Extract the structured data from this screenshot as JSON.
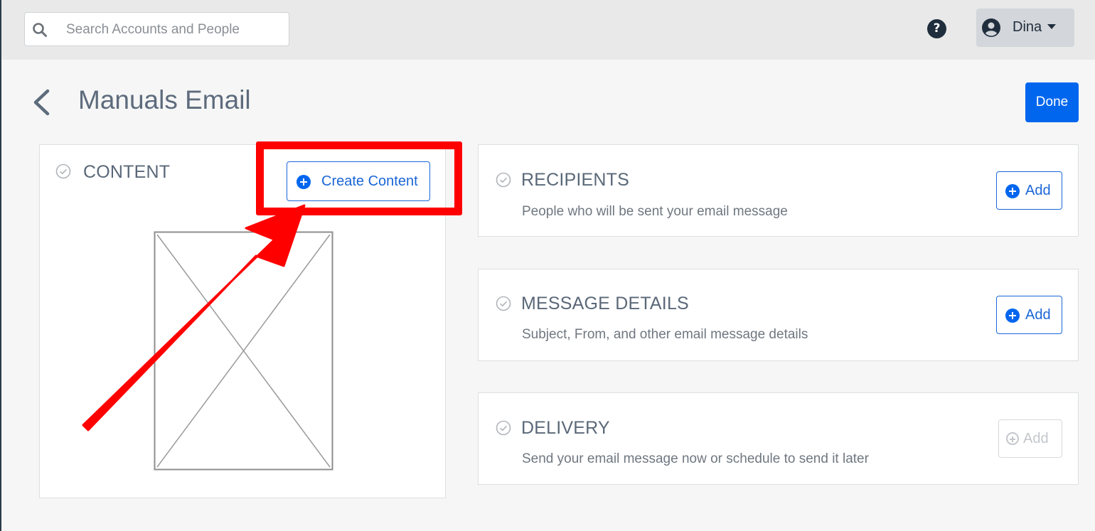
{
  "search": {
    "placeholder": "Search Accounts and People"
  },
  "header": {
    "help_symbol": "?",
    "user_name": "Dina"
  },
  "page": {
    "title": "Manuals Email",
    "done_label": "Done"
  },
  "content_card": {
    "title": "CONTENT",
    "create_label": "Create Content"
  },
  "sections": [
    {
      "title": "RECIPIENTS",
      "desc": "People who will be sent your email message",
      "add_label": "Add",
      "add_enabled": true
    },
    {
      "title": "MESSAGE DETAILS",
      "desc": "Subject, From, and other email message details",
      "add_label": "Add",
      "add_enabled": true
    },
    {
      "title": "DELIVERY",
      "desc": "Send your email message now or schedule to send it later",
      "add_label": "Add",
      "add_enabled": false
    }
  ],
  "colors": {
    "primary": "#0066ee",
    "annotation": "#ff0000",
    "title_text": "#5d6b7c"
  },
  "icons": [
    "search-icon",
    "help-icon",
    "user-avatar-icon",
    "caret-down-icon",
    "back-chevron-icon",
    "check-circle-icon",
    "plus-circle-icon",
    "image-placeholder-icon"
  ]
}
